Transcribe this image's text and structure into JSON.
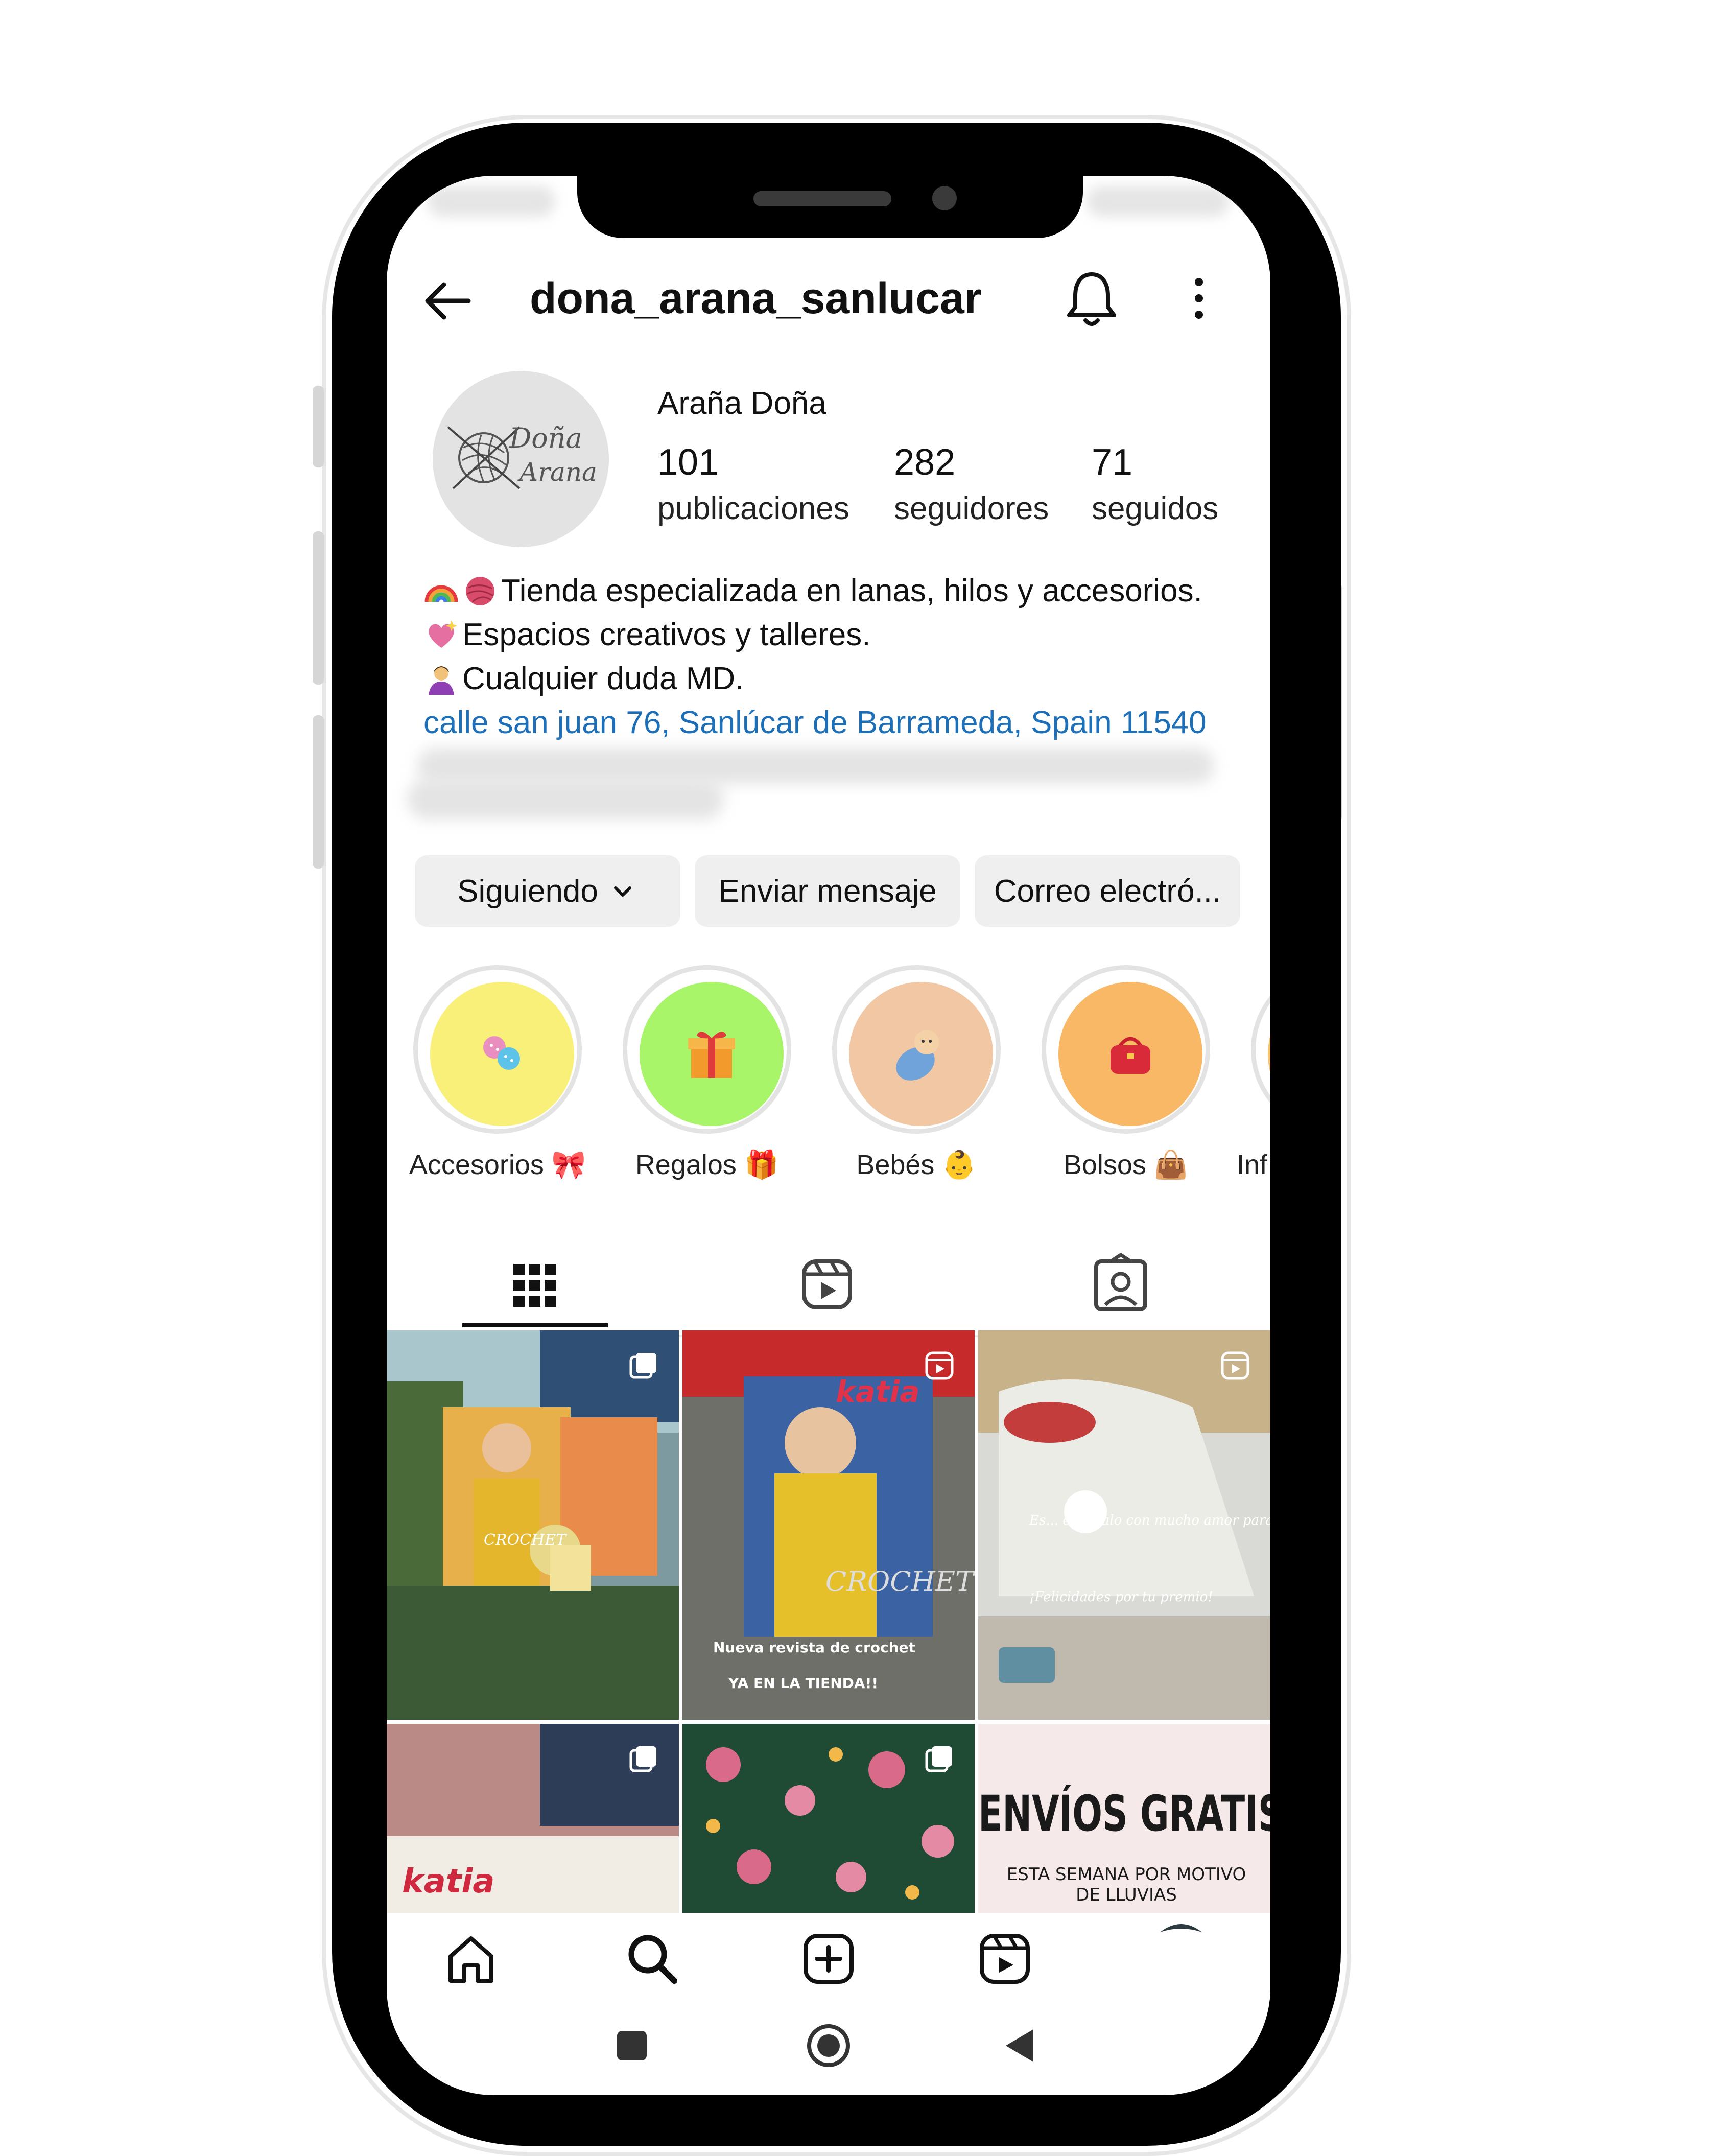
{
  "profile": {
    "username": "dona_arana_sanlucar",
    "display_name": "Araña Doña",
    "avatar_text_1": "Doña",
    "avatar_text_2": "Arana"
  },
  "stats": [
    {
      "value": "101",
      "label": "publicaciones"
    },
    {
      "value": "282",
      "label": "seguidores"
    },
    {
      "value": "71",
      "label": "seguidos"
    }
  ],
  "bio": {
    "line1": "Tienda especializada en lanas, hilos y accesorios.",
    "line2": "Espacios creativos y talleres.",
    "line3": "Cualquier duda MD.",
    "address": "calle san juan 76, Sanlúcar de Barrameda, Spain 11540"
  },
  "actions": {
    "following": "Siguiendo",
    "message": "Enviar mensaje",
    "email": "Correo electró..."
  },
  "highlights": [
    {
      "label": "Accesorios 🎀",
      "color": "#f9f07a"
    },
    {
      "label": "Regalos 🎁",
      "color": "#a8f56a"
    },
    {
      "label": "Bebés 👶",
      "color": "#f1c7a4"
    },
    {
      "label": "Bolsos 👜",
      "color": "#f8b865"
    },
    {
      "label": "Inf",
      "color": "#f8c26a"
    }
  ],
  "tabs": [
    "grid-icon",
    "reels-icon",
    "tagged-icon"
  ],
  "posts": {
    "p1_text": "CROCHET",
    "p2_text_1": "CROCHET",
    "p2_text_2": "Nueva revista de crochet",
    "p2_text_3": "YA EN LA TIENDA!!",
    "p3_text_1": "Es... el regalo con mucho amor para Marian",
    "p3_text_2": "¡Felicidades por tu premio!",
    "p4_text": "katia",
    "p6_text_1": "ENVÍOS GRATIS",
    "p6_text_2": "ESTA SEMANA POR MOTIVO DE LLUVIAS"
  },
  "brand_text": "katia",
  "colors": {
    "link": "#1d6fb8",
    "button_bg": "#efefef",
    "phone_frame": "#000000"
  }
}
